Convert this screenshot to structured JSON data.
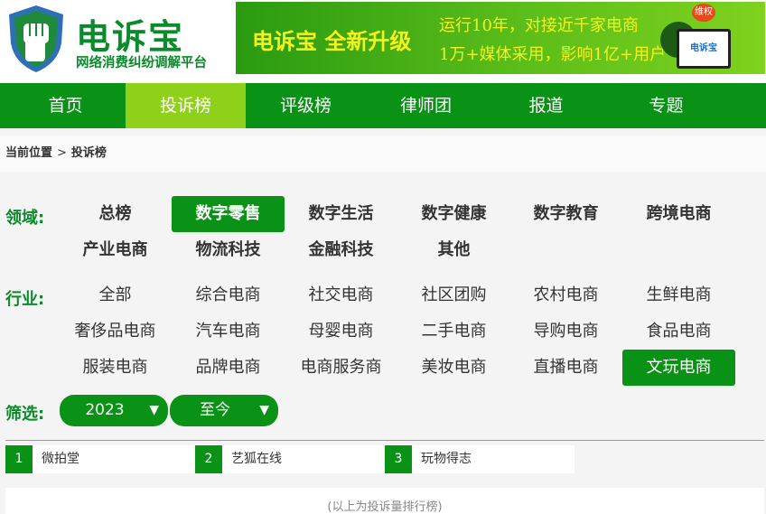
{
  "logo": {
    "title": "电诉宝",
    "subtitle": "网络消费纠纷调解平台"
  },
  "banner": {
    "slogan": "电诉宝  全新升级",
    "line1": "运行10年，对接近千家电商",
    "line2": "1万+媒体采用，影响1亿+用户",
    "badge": "维权",
    "screen_text": "电诉宝"
  },
  "nav": {
    "items": [
      "首页",
      "投诉榜",
      "评级榜",
      "律师团",
      "报道",
      "专题"
    ],
    "active": "投诉榜"
  },
  "breadcrumb": {
    "current_label": "当前位置",
    "separator": ">",
    "page": "投诉榜"
  },
  "filters": {
    "domain_label": "领域:",
    "domains": [
      "总榜",
      "数字零售",
      "数字生活",
      "数字健康",
      "数字教育",
      "跨境电商",
      "产业电商",
      "物流科技",
      "金融科技",
      "其他"
    ],
    "domain_active": "数字零售",
    "industry_label": "行业:",
    "industries": [
      "全部",
      "综合电商",
      "社交电商",
      "社区团购",
      "农村电商",
      "生鲜电商",
      "奢侈品电商",
      "汽车电商",
      "母婴电商",
      "二手电商",
      "导购电商",
      "食品电商",
      "服装电商",
      "品牌电商",
      "电商服务商",
      "美妆电商",
      "直播电商",
      "文玩电商"
    ],
    "industry_active": "文玩电商",
    "screen_label": "筛选:",
    "year_from": "2023",
    "year_to": "至今",
    "arrow": "▼"
  },
  "ranking": [
    {
      "rank": "1",
      "name": "微拍堂"
    },
    {
      "rank": "2",
      "name": "艺狐在线"
    },
    {
      "rank": "3",
      "name": "玩物得志"
    }
  ],
  "footnote": "(以上为投诉量排行榜)",
  "colors": {
    "brand_green": "#0a9216",
    "nav_active": "#8fd11a",
    "label_green": "#0a8a2a"
  }
}
